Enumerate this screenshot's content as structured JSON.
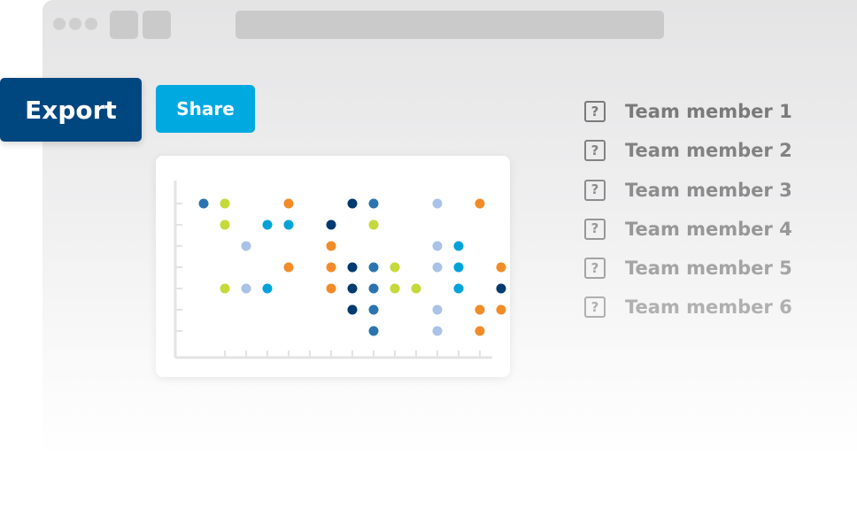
{
  "toolbar": {
    "export_label": "Export",
    "share_label": "Share"
  },
  "members": [
    {
      "label": "Team member 1",
      "icon": "question-mark-icon",
      "color": "#7a7a7a"
    },
    {
      "label": "Team member 2",
      "icon": "question-mark-icon",
      "color": "#828282"
    },
    {
      "label": "Team member 3",
      "icon": "question-mark-icon",
      "color": "#8c8c8c"
    },
    {
      "label": "Team member 4",
      "icon": "question-mark-icon",
      "color": "#979797"
    },
    {
      "label": "Team member 5",
      "icon": "question-mark-icon",
      "color": "#a4a4a4"
    },
    {
      "label": "Team member 6",
      "icon": "question-mark-icon",
      "color": "#b0b0b0"
    }
  ],
  "colors": {
    "export": "#00467f",
    "share": "#00a9e0"
  },
  "chart_data": {
    "type": "scatter",
    "x_count": 13,
    "y_count": 7,
    "series": [
      {
        "color": "#2b74b0",
        "points": [
          [
            1,
            1
          ],
          [
            9,
            1
          ],
          [
            9,
            4
          ],
          [
            9,
            5
          ],
          [
            9,
            6
          ],
          [
            9,
            7
          ]
        ]
      },
      {
        "color": "#c5d93a",
        "points": [
          [
            2,
            1
          ],
          [
            2,
            2
          ],
          [
            9,
            2
          ],
          [
            10,
            4
          ],
          [
            2,
            5
          ],
          [
            10,
            5
          ],
          [
            11,
            5
          ]
        ]
      },
      {
        "color": "#f28c28",
        "points": [
          [
            5,
            1
          ],
          [
            14,
            1
          ],
          [
            7,
            3
          ],
          [
            5,
            4
          ],
          [
            7,
            4
          ],
          [
            15,
            4
          ],
          [
            7,
            5
          ],
          [
            14,
            6
          ],
          [
            15,
            6
          ],
          [
            14,
            7
          ]
        ]
      },
      {
        "color": "#003a70",
        "points": [
          [
            8,
            1
          ],
          [
            7,
            2
          ],
          [
            8,
            4
          ],
          [
            8,
            5
          ],
          [
            15,
            5
          ],
          [
            8,
            6
          ]
        ]
      },
      {
        "color": "#a9c3e6",
        "points": [
          [
            12,
            1
          ],
          [
            3,
            3
          ],
          [
            12,
            3
          ],
          [
            12,
            4
          ],
          [
            3,
            5
          ],
          [
            12,
            6
          ],
          [
            12,
            7
          ]
        ]
      },
      {
        "color": "#00a3d9",
        "points": [
          [
            4,
            2
          ],
          [
            5,
            2
          ],
          [
            13,
            3
          ],
          [
            13,
            4
          ],
          [
            4,
            5
          ],
          [
            13,
            5
          ]
        ]
      }
    ]
  }
}
